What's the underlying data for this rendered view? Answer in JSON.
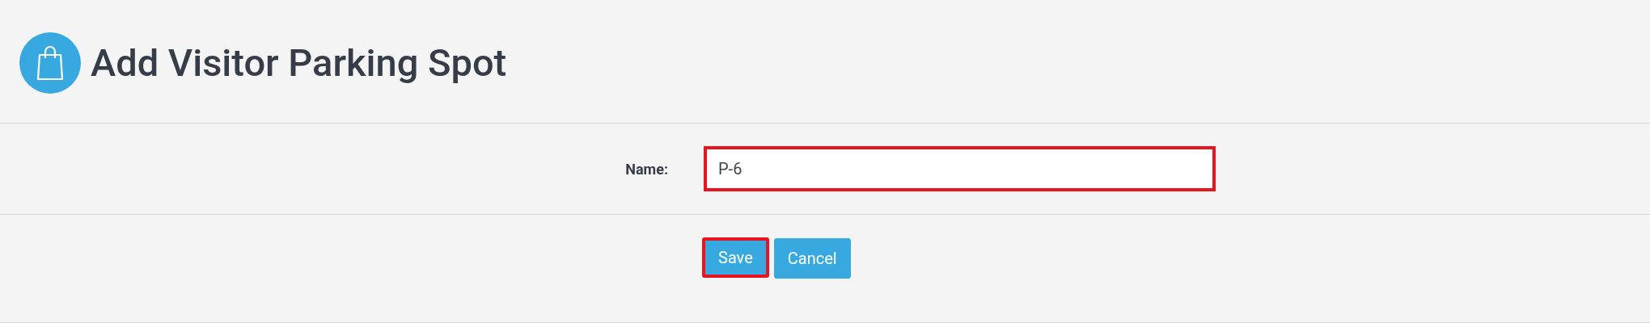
{
  "header": {
    "title": "Add Visitor Parking Spot"
  },
  "form": {
    "fields": [
      {
        "label": "Name:",
        "value": "P-6",
        "highlighted": true
      }
    ]
  },
  "buttons": [
    {
      "label": "Save",
      "highlighted": true
    },
    {
      "label": "Cancel",
      "highlighted": false
    }
  ]
}
